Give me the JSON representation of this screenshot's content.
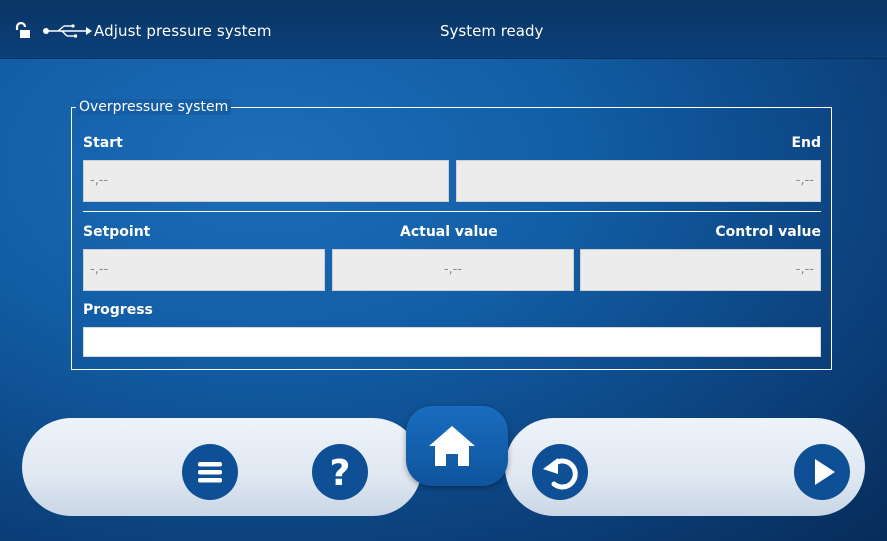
{
  "header": {
    "title": "Adjust pressure system",
    "status": "System ready",
    "icons": [
      "lock-open-icon",
      "usb-icon"
    ]
  },
  "overpressure": {
    "legend": "Overpressure system",
    "start_label": "Start",
    "end_label": "End",
    "start_value": "-,--",
    "end_value": "-,--",
    "setpoint_label": "Setpoint",
    "actual_label": "Actual value",
    "control_label": "Control value",
    "setpoint_value": "-,--",
    "actual_value": "-,--",
    "control_value": "-,--",
    "progress_label": "Progress",
    "progress_value": 0
  },
  "toolbar": {
    "icons": [
      "menu-icon",
      "help-icon",
      "home-icon",
      "back-icon",
      "play-icon"
    ]
  },
  "colors": {
    "background": "#125ea6",
    "button": "#0e4f96",
    "field": "#ececec"
  }
}
